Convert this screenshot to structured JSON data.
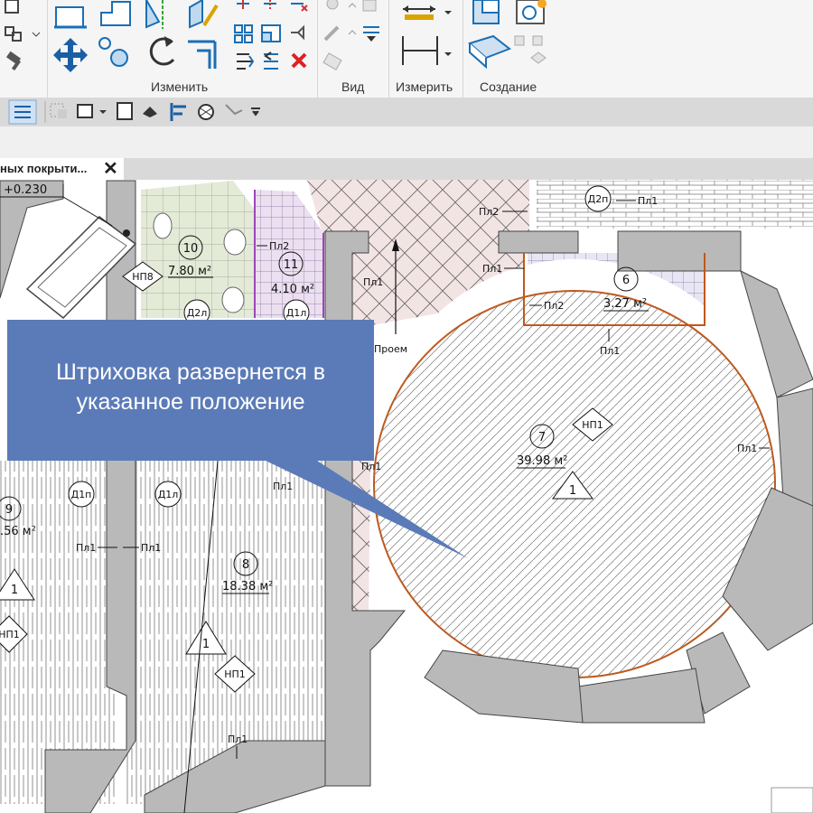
{
  "ribbon": {
    "panels": [
      {
        "title": "Изменить"
      },
      {
        "title": "Вид"
      },
      {
        "title": "Измерить"
      },
      {
        "title": "Создание"
      }
    ]
  },
  "view_tab": {
    "label": "ных покрыти...",
    "close": "✕"
  },
  "plan": {
    "level_mark": "+0.230",
    "rooms": [
      {
        "num": "10",
        "area": "7.80 м²"
      },
      {
        "num": "11",
        "area": "4.10 м²"
      },
      {
        "num": "6",
        "area": "3.27 м²"
      },
      {
        "num": "7",
        "area": "39.98 м²"
      },
      {
        "num": "8",
        "area": "18.38 м²"
      },
      {
        "num": "9",
        "area": ".56 м²"
      }
    ],
    "tags": {
      "np8": "НП8",
      "np1": "НП1",
      "d2l": "Д2л",
      "d1l": "Д1л",
      "d2p": "Д2п",
      "d1p": "Д1п",
      "pl1": "Пл1",
      "pl2": "Пл2",
      "proem": "Проем",
      "one": "1",
      "np1_short": "НП1"
    }
  },
  "callout": {
    "text_line1": "Штриховка развернется в",
    "text_line2": "указанное положение"
  }
}
